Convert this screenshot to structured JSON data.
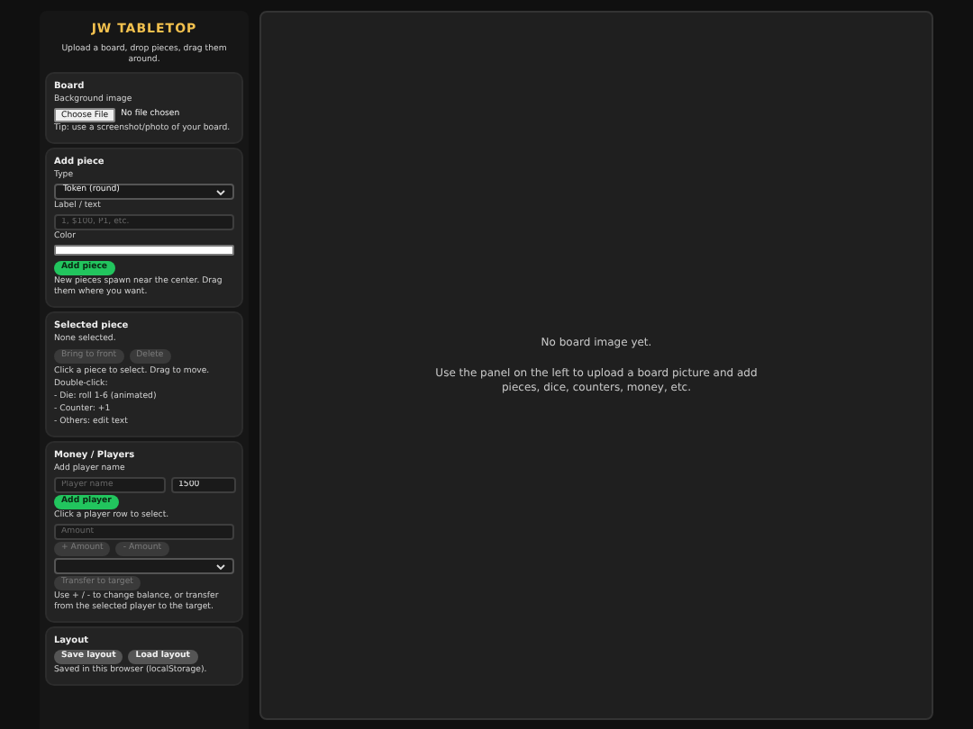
{
  "app_title": "JW TABLETOP",
  "subtitle": "Upload a board, drop pieces, drag them around.",
  "board_section": {
    "heading": "Board",
    "field_label": "Background image",
    "file_button": "Choose File",
    "file_status": "No file chosen",
    "tip": "Tip: use a screenshot/photo of your board."
  },
  "add_piece": {
    "heading": "Add piece",
    "type_label": "Type",
    "type_value": "Token (round)",
    "text_label": "Label / text",
    "text_placeholder": "1, $100, P1, etc.",
    "color_label": "Color",
    "button": "Add piece",
    "note": "New pieces spawn near the center. Drag them where you want."
  },
  "selected_piece": {
    "heading": "Selected piece",
    "status": "None selected.",
    "buttons": [
      {
        "label": "Bring to front",
        "disabled": true
      },
      {
        "label": "Delete",
        "disabled": true
      }
    ],
    "help": [
      "Click a piece to select. Drag to move.",
      "Double-click:",
      "- Die: roll 1-6 (animated)",
      "- Counter: +1",
      "- Others: edit text"
    ]
  },
  "money": {
    "heading": "Money / Players",
    "name_label": "Add player name",
    "name_placeholder": "Player name",
    "amount_value": "1500",
    "add_button": "Add player",
    "hint": "Click a player row to select.",
    "amount_placeholder": "Amount",
    "amount_buttons": [
      {
        "label": "+ Amount",
        "disabled": true
      },
      {
        "label": "- Amount",
        "disabled": true
      }
    ],
    "transfer_button": {
      "label": "Transfer to target",
      "disabled": true
    },
    "note": "Use + / - to change balance, or transfer from the selected player to the target."
  },
  "layout": {
    "heading": "Layout",
    "buttons": [
      {
        "label": "Save layout",
        "disabled": false
      },
      {
        "label": "Load layout",
        "disabled": false
      }
    ],
    "note": "Saved in this browser (localStorage)."
  },
  "board": {
    "empty_title": "No board image yet.",
    "empty_text": "Use the panel on the left to upload a board picture and add pieces, dice, counters, money, etc."
  }
}
